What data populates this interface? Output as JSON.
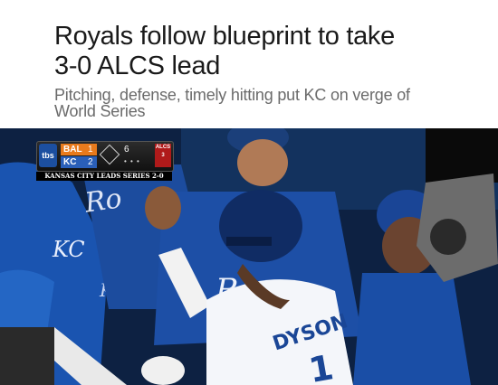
{
  "article": {
    "headline_line1": "Royals follow blueprint to take",
    "headline_line2": "3-0 ALCS lead",
    "subhead_line1": "Pitching, defense, timely hitting put KC on verge of",
    "subhead_line2": "World Series"
  },
  "scorebug": {
    "network": "tbs",
    "team_away": "BAL",
    "team_home": "KC",
    "score_away": "1",
    "score_home": "2",
    "inning": "6",
    "series_label": "ALCS",
    "series_game": "3",
    "caption": "KANSAS CITY LEADS SERIES 2-0"
  },
  "photo": {
    "jersey_name": "DYSON",
    "jersey_number": "1",
    "jersey_script_left": "Ro",
    "jersey_script_right": "Roy",
    "logo_text": "KC",
    "logo_text2": "KC"
  },
  "colors": {
    "royals_blue": "#1b4a9c",
    "dugout_navy": "#0c1e3c",
    "headline": "#1a1a1a",
    "subhead": "#6b6b6b"
  }
}
